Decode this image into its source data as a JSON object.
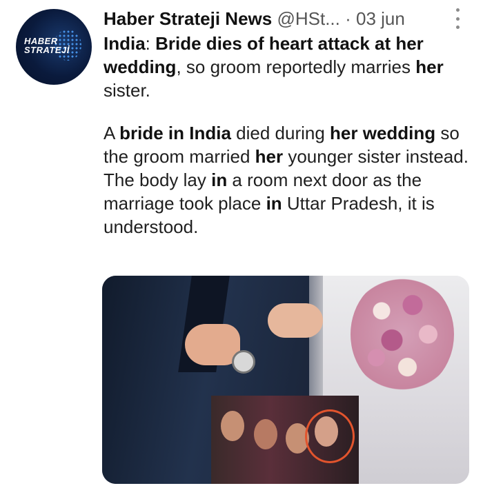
{
  "tweet": {
    "author_name": "Haber Strateji News",
    "handle": "@HSt...",
    "separator": "·",
    "date": "03 jun",
    "avatar": {
      "logo_line1": "HABER",
      "logo_line2": "STRATEJİ"
    },
    "headline": [
      {
        "text": "India",
        "bold": true
      },
      {
        "text": ": ",
        "bold": false
      },
      {
        "text": "Bride dies of heart attack at her wedding",
        "bold": true
      },
      {
        "text": ", so groom reportedly marries ",
        "bold": false
      },
      {
        "text": "her",
        "bold": true
      },
      {
        "text": " sister.",
        "bold": false
      }
    ],
    "body": [
      {
        "text": "A ",
        "bold": false
      },
      {
        "text": "bride in India",
        "bold": true
      },
      {
        "text": " died during ",
        "bold": false
      },
      {
        "text": "her wedding",
        "bold": true
      },
      {
        "text": " so the groom married ",
        "bold": false
      },
      {
        "text": "her",
        "bold": true
      },
      {
        "text": " younger sister instead. The body lay ",
        "bold": false
      },
      {
        "text": "in",
        "bold": true
      },
      {
        "text": " a room next door as the marriage took place ",
        "bold": false
      },
      {
        "text": "in",
        "bold": true
      },
      {
        "text": " Uttar Pradesh, it is understood.",
        "bold": false
      }
    ],
    "menu_icon": "more-vertical-icon",
    "colors": {
      "highlight_circle": "#e2542d",
      "avatar_bg": "#0a1a3c"
    }
  }
}
